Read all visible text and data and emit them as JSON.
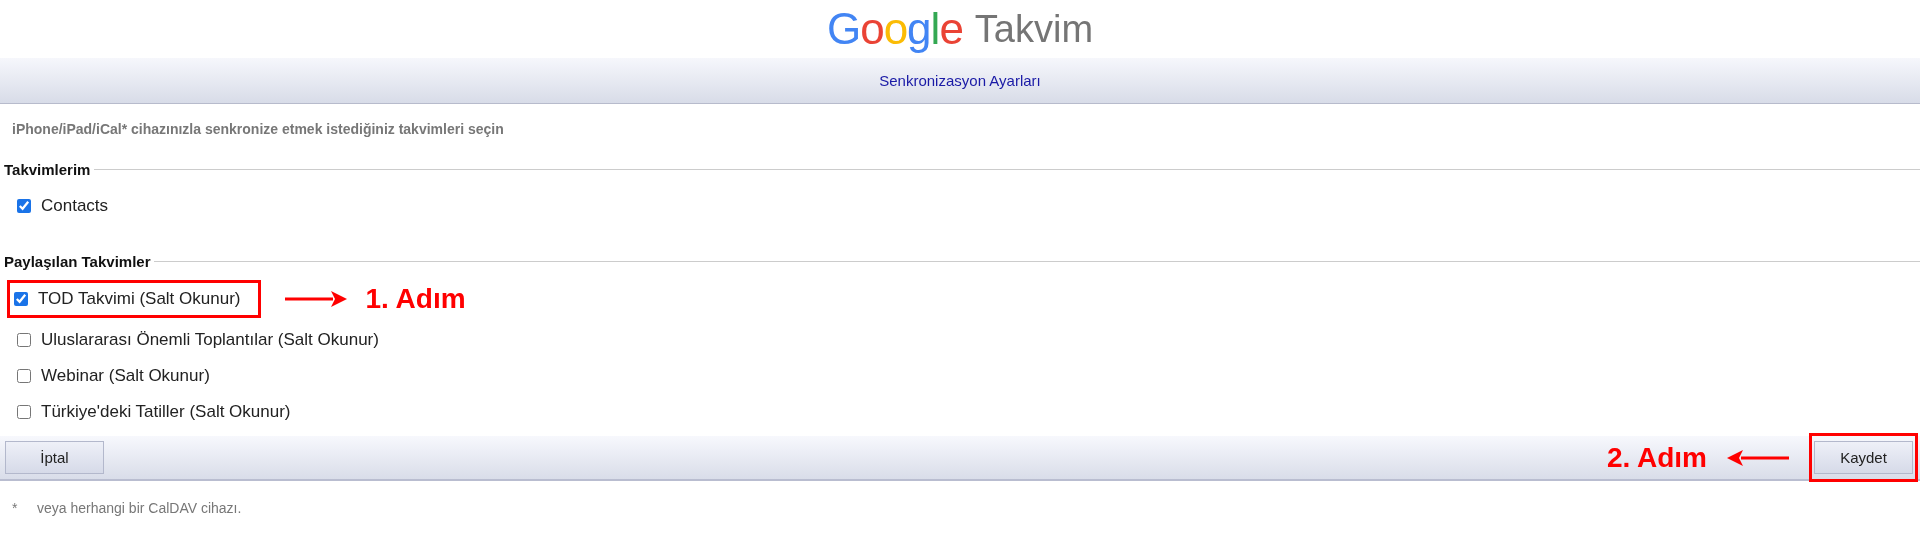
{
  "logo": {
    "brand": "Google",
    "product": "Takvim"
  },
  "title": "Senkronizasyon Ayarları",
  "instruction": "iPhone/iPad/iCal* cihazınızla senkronize etmek istediğiniz takvimleri seçin",
  "sections": [
    {
      "title": "Takvimlerim",
      "calendars": [
        {
          "label": "Contacts",
          "checked": true,
          "highlighted": false
        }
      ]
    },
    {
      "title": "Paylaşılan Takvimler",
      "calendars": [
        {
          "label": "TOD Takvimi (Salt Okunur)",
          "checked": true,
          "highlighted": true,
          "annotation": "1. Adım"
        },
        {
          "label": "Uluslararası Önemli Toplantılar (Salt Okunur)",
          "checked": false,
          "highlighted": false
        },
        {
          "label": "Webinar (Salt Okunur)",
          "checked": false,
          "highlighted": false
        },
        {
          "label": "Türkiye'deki Tatiller (Salt Okunur)",
          "checked": false,
          "highlighted": false
        }
      ]
    }
  ],
  "cancel_button": {
    "label": "İptal"
  },
  "save_button": {
    "label": "Kaydet",
    "highlighted": true,
    "annotation": "2. Adım"
  },
  "footnote": {
    "mark": "*",
    "text": "veya herhangi bir CalDAV cihazı."
  }
}
